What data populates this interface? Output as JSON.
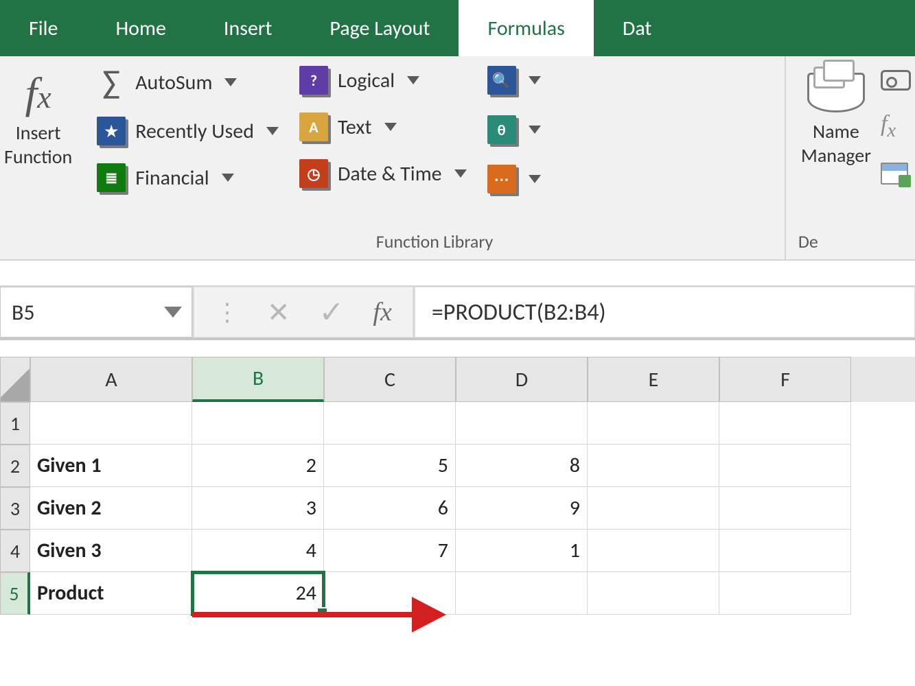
{
  "tabs": {
    "file": "File",
    "home": "Home",
    "insert": "Insert",
    "page_layout": "Page Layout",
    "formulas": "Formulas",
    "data": "Dat"
  },
  "ribbon": {
    "insert_function": {
      "label_line1": "Insert",
      "label_line2": "Function"
    },
    "function_library": {
      "group_label": "Function Library",
      "autosum": "AutoSum",
      "recently_used": "Recently Used",
      "financial": "Financial",
      "logical": "Logical",
      "text": "Text",
      "date_time": "Date & Time"
    },
    "lookup_glyph": "🔍",
    "theta_glyph": "θ",
    "more_glyph": "⋯",
    "name_manager": {
      "label_line1": "Name",
      "label_line2": "Manager"
    },
    "defined_group_label_partial": "De"
  },
  "formula_bar": {
    "cell_ref": "B5",
    "formula": "=PRODUCT(B2:B4)",
    "fx_label": "fx"
  },
  "columns": [
    "A",
    "B",
    "C",
    "D",
    "E",
    "F"
  ],
  "rows_shown": [
    "1",
    "2",
    "3",
    "4",
    "5"
  ],
  "selected_column": "B",
  "selected_row": "5",
  "cells": {
    "A2": "Given 1",
    "B2": "2",
    "C2": "5",
    "D2": "8",
    "A3": "Given 2",
    "B3": "3",
    "C3": "6",
    "D3": "9",
    "A4": "Given 3",
    "B4": "4",
    "C4": "7",
    "D4": "1",
    "A5": "Product",
    "B5": "24"
  }
}
